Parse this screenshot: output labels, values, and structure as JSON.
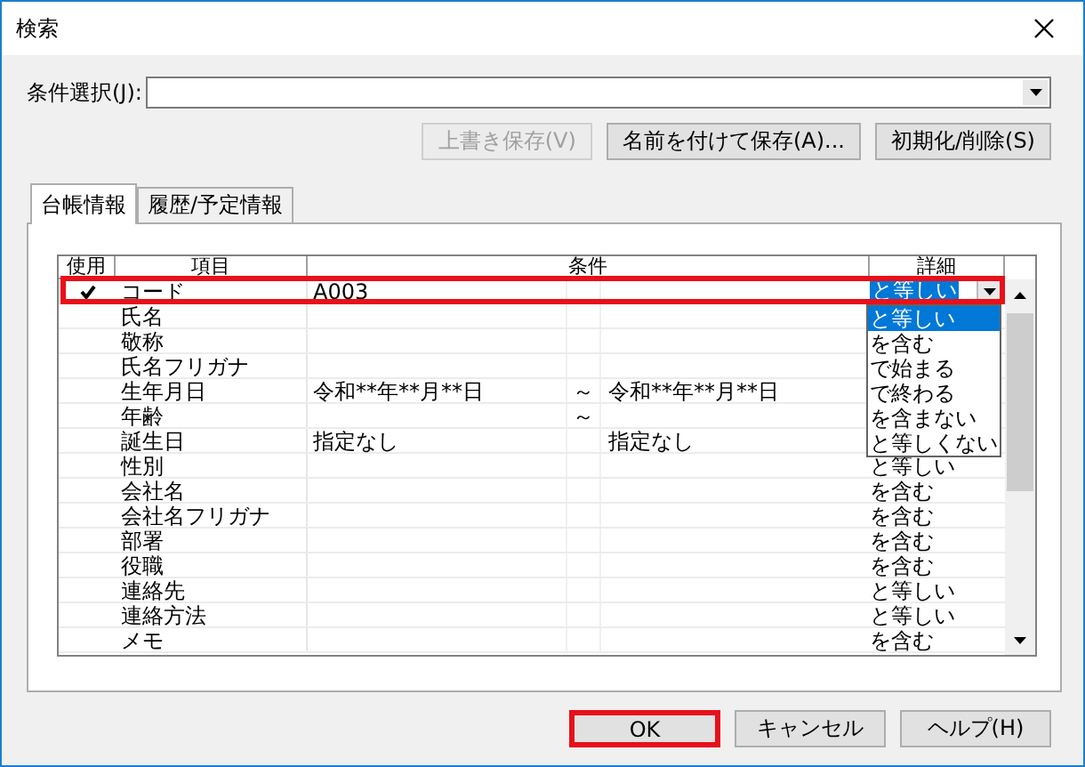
{
  "window": {
    "title": "検索"
  },
  "condition_select": {
    "label": "条件選択(J):"
  },
  "save_buttons": [
    {
      "label": "上書き保存(V)",
      "disabled": true
    },
    {
      "label": "名前を付けて保存(A)...",
      "disabled": false
    },
    {
      "label": "初期化/削除(S)",
      "disabled": false
    }
  ],
  "tabs": [
    {
      "label": "台帳情報",
      "selected": true
    },
    {
      "label": "履歴/予定情報",
      "selected": false
    }
  ],
  "grid": {
    "columns": [
      "使用",
      "項目",
      "条件",
      "詳細"
    ],
    "rows": [
      {
        "item": "コード",
        "used": true,
        "highlighted": true,
        "value": "A003",
        "detail": "と等しい",
        "detail_open": true
      },
      {
        "item": "氏名",
        "used": false,
        "highlighted": false
      },
      {
        "item": "敬称",
        "used": false,
        "highlighted": false
      },
      {
        "item": "氏名フリガナ",
        "used": false,
        "highlighted": false
      },
      {
        "item": "生年月日",
        "used": false,
        "highlighted": false,
        "value": "令和**年**月**日",
        "range_mark": "～",
        "value_to": "令和**年**月**日"
      },
      {
        "item": "年齢",
        "used": false,
        "highlighted": false,
        "range_mark": "～"
      },
      {
        "item": "誕生日",
        "used": false,
        "highlighted": false,
        "value": "指定なし",
        "value_to": "指定なし"
      },
      {
        "item": "性別",
        "used": false,
        "highlighted": false,
        "detail": "と等しい",
        "detail_open": false
      },
      {
        "item": "会社名",
        "used": false,
        "highlighted": false,
        "detail": "を含む",
        "detail_open": false
      },
      {
        "item": "会社名フリガナ",
        "used": false,
        "highlighted": false,
        "detail": "を含む",
        "detail_open": false
      },
      {
        "item": "部署",
        "used": false,
        "highlighted": false,
        "detail": "を含む",
        "detail_open": false
      },
      {
        "item": "役職",
        "used": false,
        "highlighted": false,
        "detail": "を含む",
        "detail_open": false
      },
      {
        "item": "連絡先",
        "used": false,
        "highlighted": false,
        "detail": "と等しい",
        "detail_open": false
      },
      {
        "item": "連絡方法",
        "used": false,
        "highlighted": false,
        "detail": "と等しい",
        "detail_open": false
      },
      {
        "item": "メモ",
        "used": false,
        "highlighted": false,
        "detail": "を含む",
        "detail_open": false
      }
    ],
    "detail_options": [
      {
        "label": "と等しい",
        "selected": true
      },
      {
        "label": "を含む",
        "selected": false
      },
      {
        "label": "で始まる",
        "selected": false
      },
      {
        "label": "で終わる",
        "selected": false
      },
      {
        "label": "を含まない",
        "selected": false
      },
      {
        "label": "と等しくない",
        "selected": false
      }
    ]
  },
  "dialog_buttons": [
    {
      "label": "OK",
      "highlighted": true
    },
    {
      "label": "キャンセル",
      "highlighted": false
    },
    {
      "label": "ヘルプ(H)",
      "highlighted": false
    }
  ]
}
